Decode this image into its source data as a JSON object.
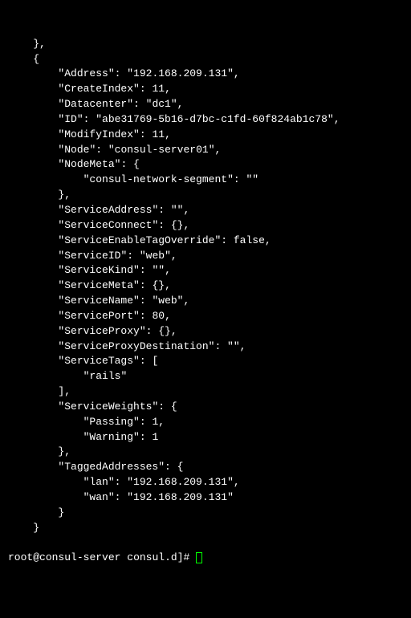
{
  "json": {
    "Address": "192.168.209.131",
    "CreateIndex": 11,
    "Datacenter": "dc1",
    "ID": "abe31769-5b16-d7bc-c1fd-60f824ab1c78",
    "ModifyIndex": 11,
    "Node": "consul-server01",
    "NodeMeta": {
      "consul-network-segment": ""
    },
    "ServiceAddress": "",
    "ServiceConnect": "{}",
    "ServiceEnableTagOverride": "false",
    "ServiceID": "web",
    "ServiceKind": "",
    "ServiceMeta": "{}",
    "ServiceName": "web",
    "ServicePort": 80,
    "ServiceProxy": "{}",
    "ServiceProxyDestination": "",
    "ServiceTags": [
      "rails"
    ],
    "ServiceWeights": {
      "Passing": 1,
      "Warning": 1
    },
    "TaggedAddresses": {
      "lan": "192.168.209.131",
      "wan": "192.168.209.131"
    }
  },
  "prompt": {
    "user": "root",
    "host": "consul-server",
    "cwd": "consul.d",
    "symbol": "#"
  },
  "labels": {
    "Address": "Address",
    "CreateIndex": "CreateIndex",
    "Datacenter": "Datacenter",
    "ID": "ID",
    "ModifyIndex": "ModifyIndex",
    "Node": "Node",
    "NodeMeta": "NodeMeta",
    "consul_network_segment": "consul-network-segment",
    "ServiceAddress": "ServiceAddress",
    "ServiceConnect": "ServiceConnect",
    "ServiceEnableTagOverride": "ServiceEnableTagOverride",
    "ServiceID": "ServiceID",
    "ServiceKind": "ServiceKind",
    "ServiceMeta": "ServiceMeta",
    "ServiceName": "ServiceName",
    "ServicePort": "ServicePort",
    "ServiceProxy": "ServiceProxy",
    "ServiceProxyDestination": "ServiceProxyDestination",
    "ServiceTags": "ServiceTags",
    "ServiceWeights": "ServiceWeights",
    "Passing": "Passing",
    "Warning": "Warning",
    "TaggedAddresses": "TaggedAddresses",
    "lan": "lan",
    "wan": "wan",
    "rails": "rails"
  }
}
